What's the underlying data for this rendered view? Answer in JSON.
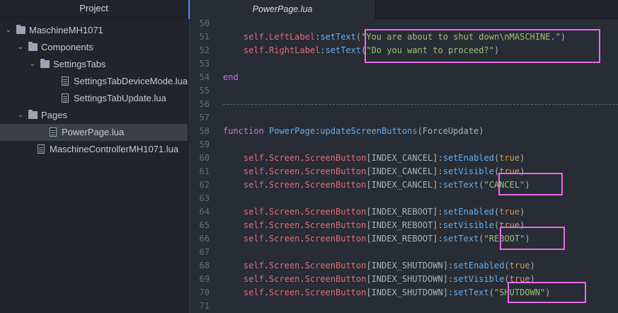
{
  "sidebar": {
    "title": "Project",
    "items": [
      {
        "label": "MaschineMH1071",
        "type": "folder",
        "expanded": true,
        "depth": 0
      },
      {
        "label": "Components",
        "type": "folder",
        "expanded": true,
        "depth": 1
      },
      {
        "label": "SettingsTabs",
        "type": "folder",
        "expanded": true,
        "depth": 2
      },
      {
        "label": "SettingsTabDeviceMode.lua",
        "type": "file",
        "depth": 3
      },
      {
        "label": "SettingsTabUpdate.lua",
        "type": "file",
        "depth": 3
      },
      {
        "label": "Pages",
        "type": "folder",
        "expanded": true,
        "depth": 1
      },
      {
        "label": "PowerPage.lua",
        "type": "file",
        "depth": 2,
        "selected": true
      },
      {
        "label": "MaschineControllerMH1071.lua",
        "type": "file",
        "depth": 1
      }
    ]
  },
  "tabs": [
    {
      "label": "PowerPage.lua",
      "active": true
    }
  ],
  "editor": {
    "lines": [
      {
        "num": "50",
        "parts": []
      },
      {
        "num": "51",
        "parts": [
          {
            "t": "    ",
            "c": "plain"
          },
          {
            "t": "self",
            "c": "self"
          },
          {
            "t": ".",
            "c": "plain"
          },
          {
            "t": "LeftLabel",
            "c": "self"
          },
          {
            "t": ":",
            "c": "plain"
          },
          {
            "t": "setText",
            "c": "fn"
          },
          {
            "t": "(",
            "c": "plain"
          },
          {
            "t": "\"You are about to shut down\\nMASCHINE.\"",
            "c": "str"
          },
          {
            "t": ")",
            "c": "plain"
          }
        ]
      },
      {
        "num": "52",
        "parts": [
          {
            "t": "    ",
            "c": "plain"
          },
          {
            "t": "self",
            "c": "self"
          },
          {
            "t": ".",
            "c": "plain"
          },
          {
            "t": "RightLabel",
            "c": "self"
          },
          {
            "t": ":",
            "c": "plain"
          },
          {
            "t": "setText",
            "c": "fn"
          },
          {
            "t": "(",
            "c": "plain"
          },
          {
            "t": "\"Do you want to proceed?\"",
            "c": "str"
          },
          {
            "t": ")",
            "c": "plain"
          }
        ]
      },
      {
        "num": "53",
        "parts": []
      },
      {
        "num": "54",
        "parts": [
          {
            "t": "end",
            "c": "kw"
          }
        ]
      },
      {
        "num": "55",
        "parts": []
      },
      {
        "num": "56",
        "parts": [],
        "separator": true
      },
      {
        "num": "57",
        "parts": []
      },
      {
        "num": "58",
        "parts": [
          {
            "t": "function ",
            "c": "kw"
          },
          {
            "t": "PowerPage",
            "c": "fn"
          },
          {
            "t": ":",
            "c": "plain"
          },
          {
            "t": "updateScreenButtons",
            "c": "fn"
          },
          {
            "t": "(ForceUpdate)",
            "c": "plain"
          }
        ]
      },
      {
        "num": "59",
        "parts": []
      },
      {
        "num": "60",
        "parts": [
          {
            "t": "    ",
            "c": "plain"
          },
          {
            "t": "self",
            "c": "self"
          },
          {
            "t": ".",
            "c": "plain"
          },
          {
            "t": "Screen",
            "c": "self"
          },
          {
            "t": ".",
            "c": "plain"
          },
          {
            "t": "ScreenButton",
            "c": "self"
          },
          {
            "t": "[INDEX_CANCEL]:",
            "c": "plain"
          },
          {
            "t": "setEnabled",
            "c": "fn"
          },
          {
            "t": "(",
            "c": "plain"
          },
          {
            "t": "true",
            "c": "bool"
          },
          {
            "t": ")",
            "c": "plain"
          }
        ]
      },
      {
        "num": "61",
        "parts": [
          {
            "t": "    ",
            "c": "plain"
          },
          {
            "t": "self",
            "c": "self"
          },
          {
            "t": ".",
            "c": "plain"
          },
          {
            "t": "Screen",
            "c": "self"
          },
          {
            "t": ".",
            "c": "plain"
          },
          {
            "t": "ScreenButton",
            "c": "self"
          },
          {
            "t": "[INDEX_CANCEL]:",
            "c": "plain"
          },
          {
            "t": "setVisible",
            "c": "fn"
          },
          {
            "t": "(",
            "c": "plain"
          },
          {
            "t": "true",
            "c": "bool"
          },
          {
            "t": ")",
            "c": "plain"
          }
        ]
      },
      {
        "num": "62",
        "parts": [
          {
            "t": "    ",
            "c": "plain"
          },
          {
            "t": "self",
            "c": "self"
          },
          {
            "t": ".",
            "c": "plain"
          },
          {
            "t": "Screen",
            "c": "self"
          },
          {
            "t": ".",
            "c": "plain"
          },
          {
            "t": "ScreenButton",
            "c": "self"
          },
          {
            "t": "[INDEX_CANCEL]:",
            "c": "plain"
          },
          {
            "t": "setText",
            "c": "fn"
          },
          {
            "t": "(",
            "c": "plain"
          },
          {
            "t": "\"CANCEL\"",
            "c": "str"
          },
          {
            "t": ")",
            "c": "plain"
          }
        ]
      },
      {
        "num": "63",
        "parts": []
      },
      {
        "num": "64",
        "parts": [
          {
            "t": "    ",
            "c": "plain"
          },
          {
            "t": "self",
            "c": "self"
          },
          {
            "t": ".",
            "c": "plain"
          },
          {
            "t": "Screen",
            "c": "self"
          },
          {
            "t": ".",
            "c": "plain"
          },
          {
            "t": "ScreenButton",
            "c": "self"
          },
          {
            "t": "[INDEX_REBOOT]:",
            "c": "plain"
          },
          {
            "t": "setEnabled",
            "c": "fn"
          },
          {
            "t": "(",
            "c": "plain"
          },
          {
            "t": "true",
            "c": "bool"
          },
          {
            "t": ")",
            "c": "plain"
          }
        ]
      },
      {
        "num": "65",
        "parts": [
          {
            "t": "    ",
            "c": "plain"
          },
          {
            "t": "self",
            "c": "self"
          },
          {
            "t": ".",
            "c": "plain"
          },
          {
            "t": "Screen",
            "c": "self"
          },
          {
            "t": ".",
            "c": "plain"
          },
          {
            "t": "ScreenButton",
            "c": "self"
          },
          {
            "t": "[INDEX_REBOOT]:",
            "c": "plain"
          },
          {
            "t": "setVisible",
            "c": "fn"
          },
          {
            "t": "(",
            "c": "plain"
          },
          {
            "t": "true",
            "c": "bool"
          },
          {
            "t": ")",
            "c": "plain"
          }
        ]
      },
      {
        "num": "66",
        "parts": [
          {
            "t": "    ",
            "c": "plain"
          },
          {
            "t": "self",
            "c": "self"
          },
          {
            "t": ".",
            "c": "plain"
          },
          {
            "t": "Screen",
            "c": "self"
          },
          {
            "t": ".",
            "c": "plain"
          },
          {
            "t": "ScreenButton",
            "c": "self"
          },
          {
            "t": "[INDEX_REBOOT]:",
            "c": "plain"
          },
          {
            "t": "setText",
            "c": "fn"
          },
          {
            "t": "(",
            "c": "plain"
          },
          {
            "t": "\"REBOOT\"",
            "c": "str"
          },
          {
            "t": ")",
            "c": "plain"
          }
        ]
      },
      {
        "num": "67",
        "parts": []
      },
      {
        "num": "68",
        "parts": [
          {
            "t": "    ",
            "c": "plain"
          },
          {
            "t": "self",
            "c": "self"
          },
          {
            "t": ".",
            "c": "plain"
          },
          {
            "t": "Screen",
            "c": "self"
          },
          {
            "t": ".",
            "c": "plain"
          },
          {
            "t": "ScreenButton",
            "c": "self"
          },
          {
            "t": "[INDEX_SHUTDOWN]:",
            "c": "plain"
          },
          {
            "t": "setEnabled",
            "c": "fn"
          },
          {
            "t": "(",
            "c": "plain"
          },
          {
            "t": "true",
            "c": "bool"
          },
          {
            "t": ")",
            "c": "plain"
          }
        ]
      },
      {
        "num": "69",
        "parts": [
          {
            "t": "    ",
            "c": "plain"
          },
          {
            "t": "self",
            "c": "self"
          },
          {
            "t": ".",
            "c": "plain"
          },
          {
            "t": "Screen",
            "c": "self"
          },
          {
            "t": ".",
            "c": "plain"
          },
          {
            "t": "ScreenButton",
            "c": "self"
          },
          {
            "t": "[INDEX_SHUTDOWN]:",
            "c": "plain"
          },
          {
            "t": "setVisible",
            "c": "fn"
          },
          {
            "t": "(",
            "c": "plain"
          },
          {
            "t": "true",
            "c": "bool"
          },
          {
            "t": ")",
            "c": "plain"
          }
        ]
      },
      {
        "num": "70",
        "parts": [
          {
            "t": "    ",
            "c": "plain"
          },
          {
            "t": "self",
            "c": "self"
          },
          {
            "t": ".",
            "c": "plain"
          },
          {
            "t": "Screen",
            "c": "self"
          },
          {
            "t": ".",
            "c": "plain"
          },
          {
            "t": "ScreenButton",
            "c": "self"
          },
          {
            "t": "[INDEX_SHUTDOWN]:",
            "c": "plain"
          },
          {
            "t": "setText",
            "c": "fn"
          },
          {
            "t": "(",
            "c": "plain"
          },
          {
            "t": "\"SHUTDOWN\"",
            "c": "str"
          },
          {
            "t": ")",
            "c": "plain"
          }
        ]
      },
      {
        "num": "71",
        "parts": []
      }
    ]
  },
  "colors": {
    "highlight_box": "#e86ae8",
    "accent": "#568af2"
  }
}
